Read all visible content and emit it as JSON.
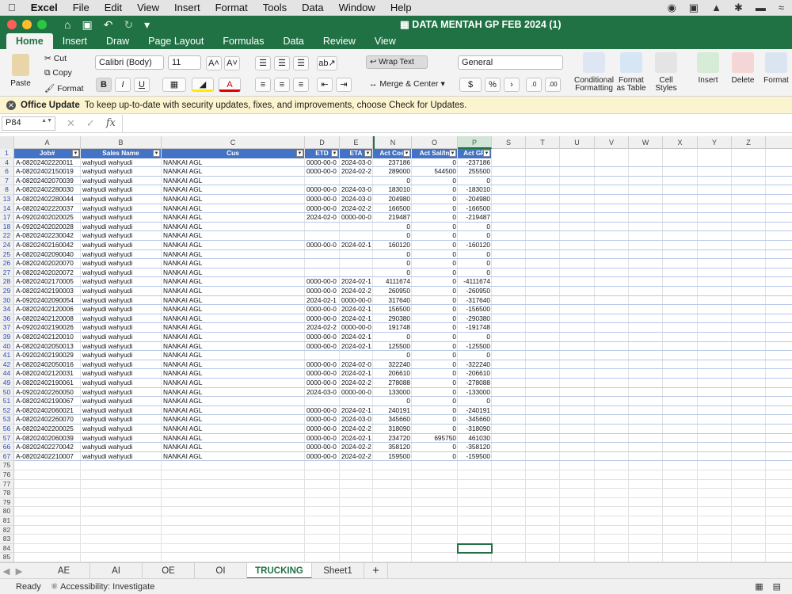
{
  "macmenu": {
    "app": "Excel",
    "items": [
      "File",
      "Edit",
      "View",
      "Insert",
      "Format",
      "Tools",
      "Data",
      "Window",
      "Help"
    ]
  },
  "window": {
    "title": "DATA MENTAH GP FEB 2024 (1)"
  },
  "ribbon_tabs": [
    "Home",
    "Insert",
    "Draw",
    "Page Layout",
    "Formulas",
    "Data",
    "Review",
    "View"
  ],
  "ribbon": {
    "paste": "Paste",
    "cut": "Cut",
    "copy": "Copy",
    "format": "Format",
    "font": "Calibri (Body)",
    "size": "11",
    "wrap": "Wrap Text",
    "merge": "Merge & Center",
    "numfmt": "General",
    "cond": "Conditional Formatting",
    "astable": "Format as Table",
    "styles": "Cell Styles",
    "insert": "Insert",
    "delete": "Delete",
    "format2": "Format"
  },
  "notice": {
    "title": "Office Update",
    "text": "To keep up-to-date with security updates, fixes, and improvements, choose Check for Updates."
  },
  "formula": {
    "namebox": "P84",
    "fx": "fx"
  },
  "columns": [
    "A",
    "B",
    "C",
    "D",
    "E",
    "N",
    "O",
    "P",
    "S",
    "T",
    "U",
    "V",
    "W",
    "X",
    "Y",
    "Z"
  ],
  "headers": [
    "Job#",
    "Sales Name",
    "Cus",
    "ETD",
    "ETA",
    "Act Cos",
    "Act Sal/In",
    "Act GP"
  ],
  "rows": [
    [
      "4",
      "A-08202402220011",
      "wahyudi wahyudi",
      "NANKAI AGL",
      "0000-00-0",
      "2024-03-0",
      "237186",
      "0",
      "-237186"
    ],
    [
      "6",
      "A-08202402150019",
      "wahyudi wahyudi",
      "NANKAI AGL",
      "0000-00-0",
      "2024-02-2",
      "289000",
      "544500",
      "255500"
    ],
    [
      "7",
      "A-08202402070039",
      "wahyudi wahyudi",
      "NANKAI AGL",
      "",
      "",
      "0",
      "0",
      "0"
    ],
    [
      "8",
      "A-08202402280030",
      "wahyudi wahyudi",
      "NANKAI AGL",
      "0000-00-0",
      "2024-03-0",
      "183010",
      "0",
      "-183010"
    ],
    [
      "13",
      "A-08202402280044",
      "wahyudi wahyudi",
      "NANKAI AGL",
      "0000-00-0",
      "2024-03-0",
      "204980",
      "0",
      "-204980"
    ],
    [
      "14",
      "A-08202402220037",
      "wahyudi wahyudi",
      "NANKAI AGL",
      "0000-00-0",
      "2024-02-2",
      "166500",
      "0",
      "-166500"
    ],
    [
      "17",
      "A-09202402020025",
      "wahyudi wahyudi",
      "NANKAI AGL",
      "2024-02-0",
      "0000-00-0",
      "219487",
      "0",
      "-219487"
    ],
    [
      "18",
      "A-09202402020028",
      "wahyudi wahyudi",
      "NANKAI AGL",
      "",
      "",
      "0",
      "0",
      "0"
    ],
    [
      "22",
      "A-08202402230042",
      "wahyudi wahyudi",
      "NANKAI AGL",
      "",
      "",
      "0",
      "0",
      "0"
    ],
    [
      "24",
      "A-08202402160042",
      "wahyudi wahyudi",
      "NANKAI AGL",
      "0000-00-0",
      "2024-02-1",
      "160120",
      "0",
      "-160120"
    ],
    [
      "25",
      "A-08202402090040",
      "wahyudi wahyudi",
      "NANKAI AGL",
      "",
      "",
      "0",
      "0",
      "0"
    ],
    [
      "26",
      "A-08202402020070",
      "wahyudi wahyudi",
      "NANKAI AGL",
      "",
      "",
      "0",
      "0",
      "0"
    ],
    [
      "27",
      "A-08202402020072",
      "wahyudi wahyudi",
      "NANKAI AGL",
      "",
      "",
      "0",
      "0",
      "0"
    ],
    [
      "28",
      "A-08202402170005",
      "wahyudi wahyudi",
      "NANKAI AGL",
      "0000-00-0",
      "2024-02-1",
      "4111674",
      "0",
      "-4111674"
    ],
    [
      "29",
      "A-08202402190003",
      "wahyudi wahyudi",
      "NANKAI AGL",
      "0000-00-0",
      "2024-02-2",
      "260950",
      "0",
      "-260950"
    ],
    [
      "30",
      "A-09202402090054",
      "wahyudi wahyudi",
      "NANKAI AGL",
      "2024-02-1",
      "0000-00-0",
      "317640",
      "0",
      "-317640"
    ],
    [
      "34",
      "A-08202402120006",
      "wahyudi wahyudi",
      "NANKAI AGL",
      "0000-00-0",
      "2024-02-1",
      "156500",
      "0",
      "-156500"
    ],
    [
      "36",
      "A-08202402120008",
      "wahyudi wahyudi",
      "NANKAI AGL",
      "0000-00-0",
      "2024-02-1",
      "290380",
      "0",
      "-290380"
    ],
    [
      "37",
      "A-09202402190026",
      "wahyudi wahyudi",
      "NANKAI AGL",
      "2024-02-2",
      "0000-00-0",
      "191748",
      "0",
      "-191748"
    ],
    [
      "39",
      "A-08202402120010",
      "wahyudi wahyudi",
      "NANKAI AGL",
      "0000-00-0",
      "2024-02-1",
      "0",
      "0",
      "0"
    ],
    [
      "40",
      "A-08202402050013",
      "wahyudi wahyudi",
      "NANKAI AGL",
      "0000-00-0",
      "2024-02-1",
      "125500",
      "0",
      "-125500"
    ],
    [
      "41",
      "A-09202402190029",
      "wahyudi wahyudi",
      "NANKAI AGL",
      "",
      "",
      "0",
      "0",
      "0"
    ],
    [
      "42",
      "A-08202402050016",
      "wahyudi wahyudi",
      "NANKAI AGL",
      "0000-00-0",
      "2024-02-0",
      "322240",
      "0",
      "-322240"
    ],
    [
      "44",
      "A-08202402120031",
      "wahyudi wahyudi",
      "NANKAI AGL",
      "0000-00-0",
      "2024-02-1",
      "206610",
      "0",
      "-206610"
    ],
    [
      "49",
      "A-08202402190061",
      "wahyudi wahyudi",
      "NANKAI AGL",
      "0000-00-0",
      "2024-02-2",
      "278088",
      "0",
      "-278088"
    ],
    [
      "50",
      "A-09202402260050",
      "wahyudi wahyudi",
      "NANKAI AGL",
      "2024-03-0",
      "0000-00-0",
      "133000",
      "0",
      "-133000"
    ],
    [
      "51",
      "A-08202402190067",
      "wahyudi wahyudi",
      "NANKAI AGL",
      "",
      "",
      "0",
      "0",
      "0"
    ],
    [
      "52",
      "A-08202402060021",
      "wahyudi wahyudi",
      "NANKAI AGL",
      "0000-00-0",
      "2024-02-1",
      "240191",
      "0",
      "-240191"
    ],
    [
      "53",
      "A-08202402260070",
      "wahyudi wahyudi",
      "NANKAI AGL",
      "0000-00-0",
      "2024-03-0",
      "345660",
      "0",
      "-345660"
    ],
    [
      "56",
      "A-08202402200025",
      "wahyudi wahyudi",
      "NANKAI AGL",
      "0000-00-0",
      "2024-02-2",
      "318090",
      "0",
      "-318090"
    ],
    [
      "57",
      "A-08202402060039",
      "wahyudi wahyudi",
      "NANKAI AGL",
      "0000-00-0",
      "2024-02-1",
      "234720",
      "695750",
      "461030"
    ],
    [
      "66",
      "A-08202402270042",
      "wahyudi wahyudi",
      "NANKAI AGL",
      "0000-00-0",
      "2024-02-2",
      "358120",
      "0",
      "-358120"
    ],
    [
      "67",
      "A-08202402210007",
      "wahyudi wahyudi",
      "NANKAI AGL",
      "0000-00-0",
      "2024-02-2",
      "159500",
      "0",
      "-159500"
    ]
  ],
  "empty_rows": [
    "75",
    "76",
    "77",
    "78",
    "79",
    "80",
    "81",
    "82",
    "83",
    "84",
    "85"
  ],
  "sheets": [
    "AE",
    "AI",
    "OE",
    "OI",
    "TRUCKING",
    "Sheet1"
  ],
  "active_sheet": "TRUCKING",
  "status": {
    "ready": "Ready",
    "access": "Accessibility: Investigate"
  }
}
